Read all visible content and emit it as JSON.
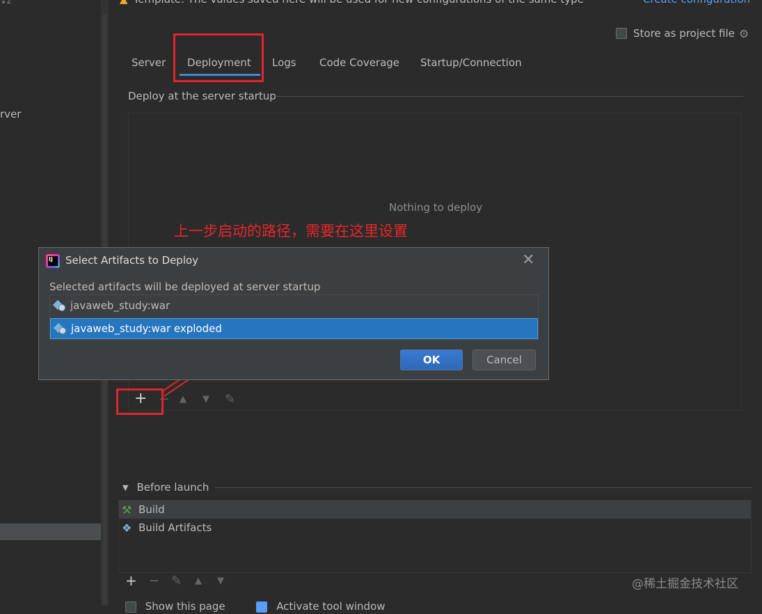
{
  "header": {
    "warning_text": "Template: The values saved here will be used for new configurations of the same type",
    "create_link": "Create configuration",
    "store_label": "Store as project file"
  },
  "sidebar": {
    "partial_text": "rver",
    "sort_label": "↓z"
  },
  "tabs": [
    {
      "label": "Server"
    },
    {
      "label": "Deployment"
    },
    {
      "label": "Logs"
    },
    {
      "label": "Code Coverage"
    },
    {
      "label": "Startup/Connection"
    }
  ],
  "deploy": {
    "section_title": "Deploy at the server startup",
    "empty_text": "Nothing to deploy"
  },
  "annotation": {
    "text": "上一步启动的路径，需要在这里设置"
  },
  "dialog": {
    "title": "Select Artifacts to Deploy",
    "subtitle": "Selected artifacts will be deployed at server startup",
    "artifacts": [
      {
        "label": "javaweb_study:war",
        "selected": false
      },
      {
        "label": "javaweb_study:war exploded",
        "selected": true
      }
    ],
    "ok_label": "OK",
    "cancel_label": "Cancel"
  },
  "toolbar_icons": {
    "add": "+",
    "remove": "−",
    "up": "▲",
    "down": "▼",
    "edit": "✎"
  },
  "before_launch": {
    "title": "Before launch",
    "items": [
      {
        "label": "Build"
      },
      {
        "label": "Build Artifacts"
      }
    ]
  },
  "bottom": {
    "show_page_label": "Show this page",
    "activate_label": "Activate tool window"
  },
  "watermark": "@稀土掘金技术社区",
  "colors": {
    "accent": "#2675bf",
    "annotation_red": "#e0262c",
    "link": "#589df6",
    "background": "#2b2b2b"
  }
}
